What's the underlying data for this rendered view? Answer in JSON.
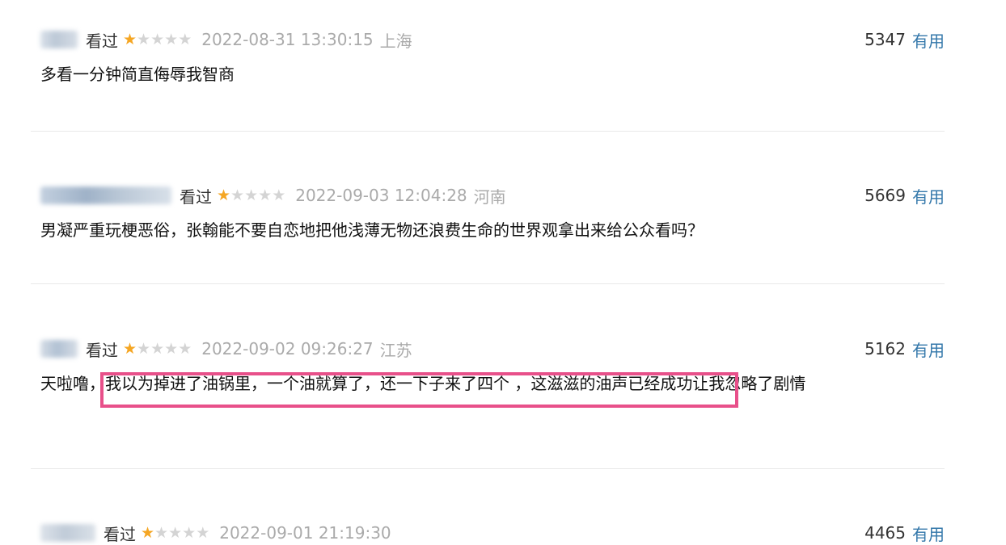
{
  "comments": [
    {
      "status": "看过",
      "rating": 1,
      "timestamp": "2022-08-31 13:30:15",
      "location": "上海",
      "votes": "5347",
      "useful": "有用",
      "text": "多看一分钟简直侮辱我智商"
    },
    {
      "status": "看过",
      "rating": 1,
      "timestamp": "2022-09-03 12:04:28",
      "location": "河南",
      "votes": "5669",
      "useful": "有用",
      "text": "男凝严重玩梗恶俗，张翰能不要自恋地把他浅薄无物还浪费生命的世界观拿出来给公众看吗？"
    },
    {
      "status": "看过",
      "rating": 1,
      "timestamp": "2022-09-02 09:26:27",
      "location": "江苏",
      "votes": "5162",
      "useful": "有用",
      "text": "天啦噜，我以为掉进了油锅里，一个油就算了，还一下子来了四个 ，这滋滋的油声已经成功让我忽略了剧情"
    },
    {
      "status": "看过",
      "rating": 1,
      "timestamp": "2022-09-01 21:19:30",
      "location": "",
      "votes": "4465",
      "useful": "有用",
      "text": ""
    }
  ],
  "colors": {
    "star_active": "#f5a623",
    "star_inactive": "#d4d4d4",
    "link": "#3377aa",
    "highlight": "#e8508a"
  },
  "icons": {
    "star": "star-icon"
  }
}
